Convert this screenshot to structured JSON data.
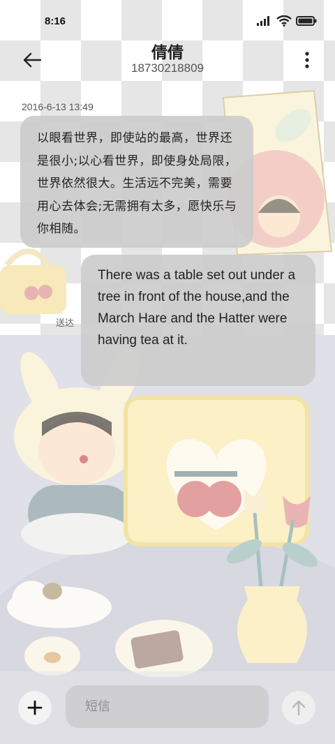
{
  "status_bar": {
    "time": "8:16",
    "icons": [
      "signal-icon",
      "wifi-icon",
      "battery-icon"
    ]
  },
  "header": {
    "contact_name": "倩倩",
    "contact_number": "18730218809",
    "back_icon": "back-arrow-icon",
    "more_icon": "more-vertical-icon"
  },
  "conversation": {
    "timestamp": "2016-6-13 13:49",
    "messages": [
      {
        "direction": "incoming",
        "text": "以眼看世界，即使站的最高，世界还是很小;以心看世界，即使身处局限，世界依然很大。生活远不完美，需要用心去体会;无需拥有太多，愿快乐与你相随。"
      },
      {
        "direction": "outgoing",
        "text": "There was a table set out under a tree in front of the house,and the March Hare and the Hatter were having tea at it."
      }
    ],
    "delivered_label": "送达"
  },
  "composer": {
    "placeholder": "短信",
    "value": "",
    "add_icon": "plus-icon",
    "send_icon": "arrow-up-icon"
  },
  "colors": {
    "bubble": "#cccccc",
    "text_primary": "#222222",
    "wallpaper_check": "#e6e6e6"
  }
}
